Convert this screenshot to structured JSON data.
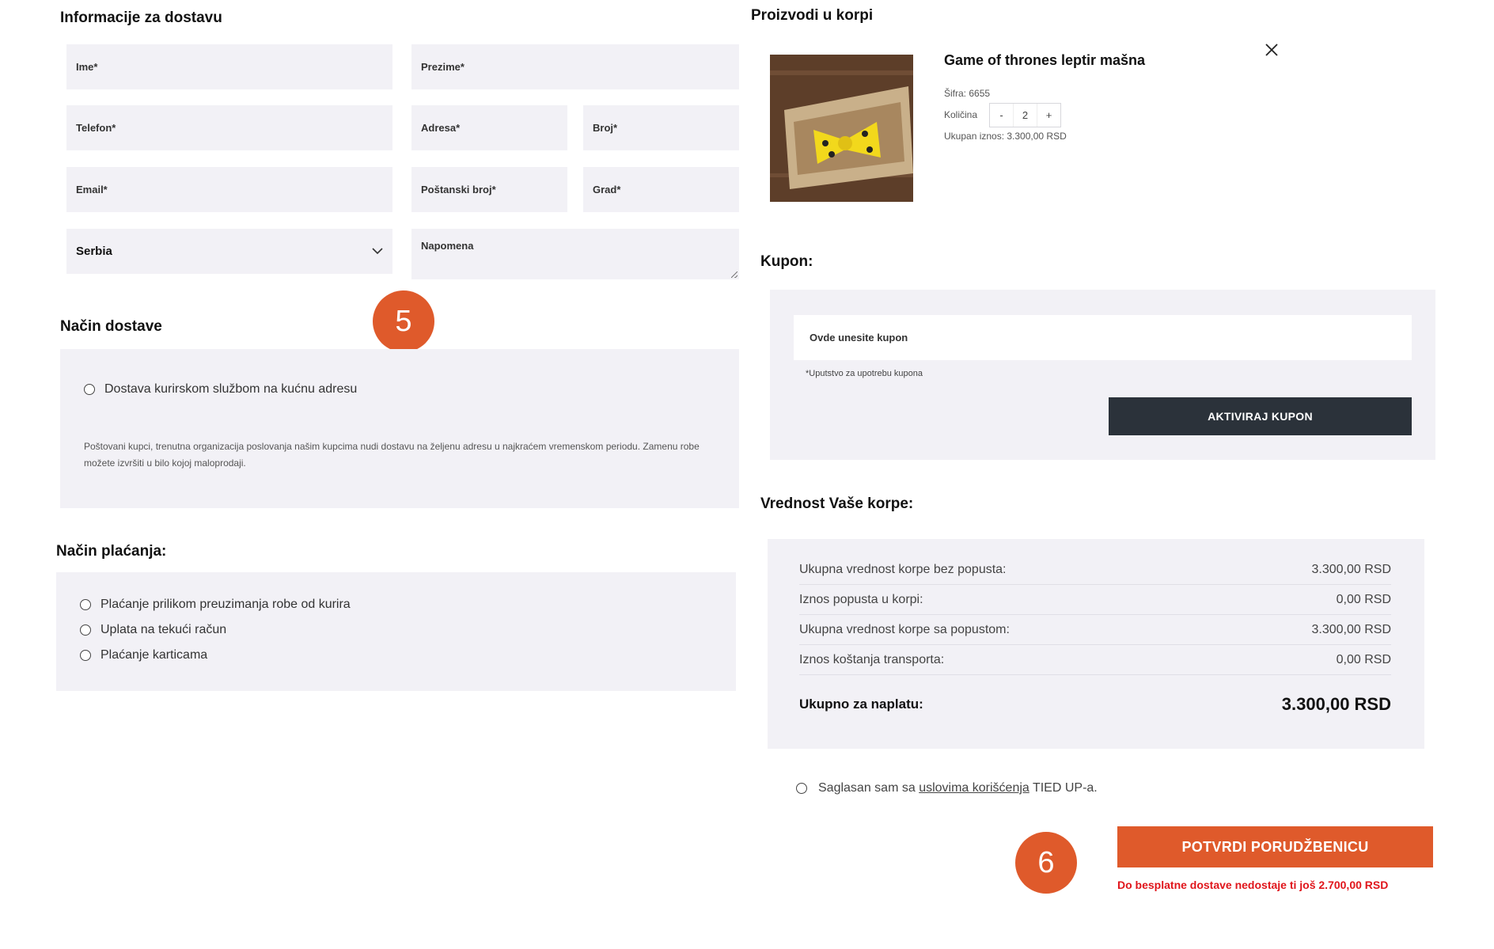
{
  "delivery_info": {
    "title": "Informacije za dostavu",
    "first_name": "Ime*",
    "last_name": "Prezime*",
    "phone": "Telefon*",
    "address": "Adresa*",
    "number": "Broj*",
    "email": "Email*",
    "postal_code": "Poštanski broj*",
    "city": "Grad*",
    "country": "Serbia",
    "note": "Napomena"
  },
  "shipping": {
    "title": "Način dostave",
    "option": "Dostava kurirskom službom na kućnu adresu",
    "note": "Poštovani kupci, trenutna organizacija poslovanja našim kupcima nudi dostavu na željenu adresu u najkraćem vremenskom periodu. Zamenu robe možete izvršiti u bilo kojoj maloprodaji."
  },
  "payment": {
    "title": "Način plaćanja:",
    "options": [
      "Plaćanje prilikom preuzimanja robe od kurira",
      "Uplata na tekući račun",
      "Plaćanje karticama"
    ]
  },
  "steps": {
    "step5": "5",
    "step6": "6"
  },
  "cart": {
    "title": "Proizvodi u korpi",
    "item": {
      "name": "Game of thrones leptir mašna",
      "sku": "Šifra: 6655",
      "qty_label": "Količina",
      "qty_minus": "-",
      "qty_value": "2",
      "qty_plus": "+",
      "total": "Ukupan iznos: 3.300,00 RSD"
    }
  },
  "coupon": {
    "title": "Kupon:",
    "placeholder": "Ovde unesite kupon",
    "hint": "*Uputstvo za upotrebu kupona",
    "button": "AKTIVIRAJ KUPON"
  },
  "summary": {
    "title": "Vrednost Vaše korpe:",
    "rows": [
      {
        "label": "Ukupna vrednost korpe bez popusta:",
        "value": "3.300,00 RSD"
      },
      {
        "label": "Iznos popusta u korpi:",
        "value": "0,00 RSD"
      },
      {
        "label": "Ukupna vrednost korpe sa popustom:",
        "value": "3.300,00 RSD"
      },
      {
        "label": "Iznos koštanja transporta:",
        "value": "0,00 RSD"
      }
    ],
    "total_label": "Ukupno za naplatu:",
    "total_value": "3.300,00 RSD"
  },
  "terms": {
    "prefix": "Saglasan sam sa",
    "link": "uslovima korišćenja",
    "suffix": "TIED UP-a."
  },
  "confirm": {
    "button": "POTVRDI PORUDŽBENICU",
    "free_shipping": "Do besplatne dostave nedostaje ti još 2.700,00 RSD"
  },
  "colors": {
    "accent": "#df5a2b",
    "dark_button": "#2b323a",
    "panel": "#f2f1f6",
    "warning": "#e0151b"
  }
}
